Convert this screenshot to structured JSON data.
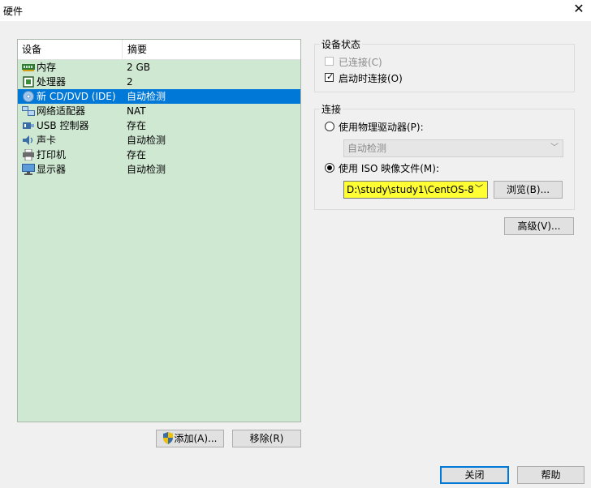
{
  "window": {
    "title": "硬件",
    "close_glyph": "✕"
  },
  "device_list": {
    "columns": {
      "device": "设备",
      "summary": "摘要"
    },
    "rows": [
      {
        "name": "内存",
        "summary": "2 GB",
        "icon": "memory-icon"
      },
      {
        "name": "处理器",
        "summary": "2",
        "icon": "cpu-icon"
      },
      {
        "name": "新 CD/DVD (IDE)",
        "summary": "自动检测",
        "icon": "cd-dvd-icon",
        "selected": true
      },
      {
        "name": "网络适配器",
        "summary": "NAT",
        "icon": "network-adapter-icon"
      },
      {
        "name": "USB 控制器",
        "summary": "存在",
        "icon": "usb-icon"
      },
      {
        "name": "声卡",
        "summary": "自动检测",
        "icon": "sound-card-icon"
      },
      {
        "name": "打印机",
        "summary": "存在",
        "icon": "printer-icon"
      },
      {
        "name": "显示器",
        "summary": "自动检测",
        "icon": "display-icon"
      }
    ]
  },
  "list_buttons": {
    "add": "添加(A)...",
    "remove": "移除(R)"
  },
  "device_status": {
    "label": "设备状态",
    "connected": {
      "label": "已连接(C)",
      "checked": false,
      "enabled": false
    },
    "connect_at_power_on": {
      "label": "启动时连接(O)",
      "checked": true
    }
  },
  "connection": {
    "label": "连接",
    "physical": {
      "label": "使用物理驱动器(P):",
      "selected": false,
      "dropdown_value": "自动检测"
    },
    "iso": {
      "label": "使用 ISO 映像文件(M):",
      "selected": true,
      "path": "D:\\study\\study1\\CentOS-8."
    },
    "browse": "浏览(B)..."
  },
  "advanced": "高级(V)...",
  "footer": {
    "close": "关闭",
    "help": "帮助"
  },
  "colors": {
    "list_bg": "#cfe8d2",
    "selected": "#0078d7",
    "iso_highlight": "#ffff33"
  }
}
